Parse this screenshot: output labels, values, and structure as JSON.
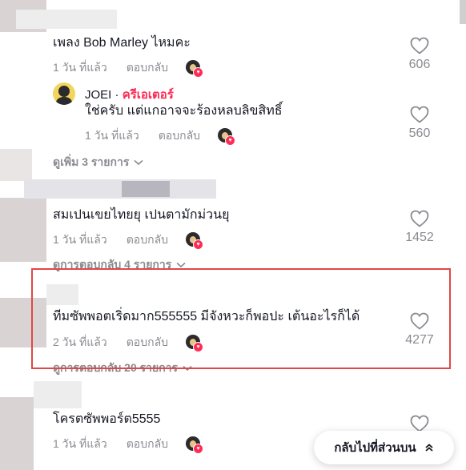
{
  "comments": [
    {
      "text": "เพลง Bob Marley ไหมคะ",
      "date": "1 วัน ที่แล้ว",
      "reply_label": "ตอบกลับ",
      "likes": "606"
    },
    {
      "text": "สมเปนเขยไทยยุ เปนตามักม่วนยุ",
      "date": "1 วัน ที่แล้ว",
      "reply_label": "ตอบกลับ",
      "likes": "1452",
      "more_replies": "ดูการตอบกลับ 4 รายการ"
    },
    {
      "text": "ทีมซัพพอตเริ่ดมาก555555 มีจังหวะก็พอปะ เต้นอะไรก็ได้",
      "date": "2 วัน ที่แล้ว",
      "reply_label": "ตอบกลับ",
      "likes": "4277",
      "more_replies": "ดูการตอบกลับ 20 รายการ"
    },
    {
      "text": "โครตซัพพอร์ต5555",
      "date": "1 วัน ที่แล้ว",
      "reply_label": "ตอบกลับ"
    }
  ],
  "reply": {
    "author": "JOEI",
    "separator": "·",
    "badge": "ครีเอเตอร์",
    "text": "ใช่ครับ แต่แกอาจจะร้องหลบลิขสิทธิ์",
    "date": "1 วัน ที่แล้ว",
    "reply_label": "ตอบกลับ",
    "likes": "560"
  },
  "view_more_label": "ดูเพิ่ม 3 รายการ",
  "back_to_top_label": "กลับไปที่ส่วนบน",
  "colors": {
    "accent": "#fe2c55",
    "highlight": "#e04848",
    "muted": "#8a8b91"
  }
}
